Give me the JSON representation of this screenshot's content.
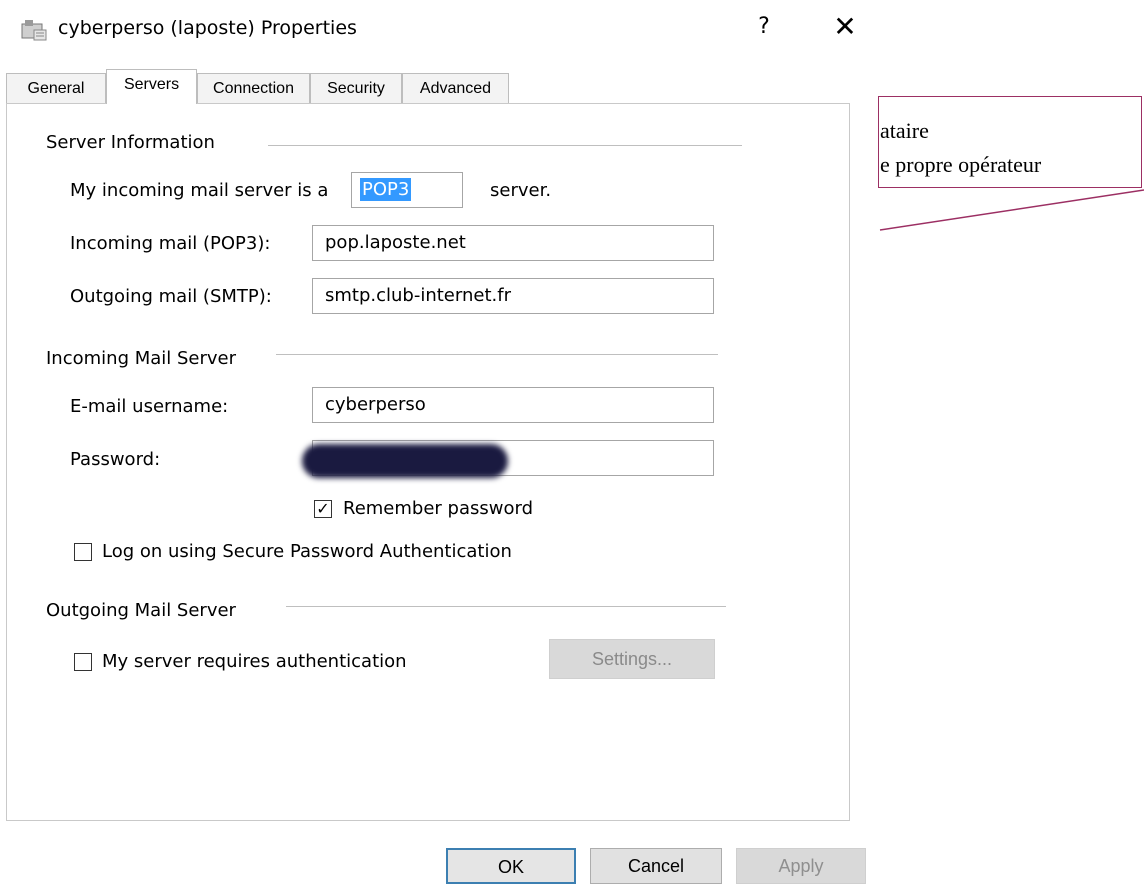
{
  "window": {
    "title": "cyberperso (laposte) Properties",
    "help_label": "?",
    "close_label": "✕"
  },
  "tabs": [
    {
      "label": "General"
    },
    {
      "label": "Servers"
    },
    {
      "label": "Connection"
    },
    {
      "label": "Security"
    },
    {
      "label": "Advanced"
    }
  ],
  "active_tab": "Servers",
  "server_info": {
    "heading": "Server Information",
    "incoming_type_prefix": "My incoming mail server is a",
    "incoming_type_value": "POP3",
    "incoming_type_suffix": "server.",
    "incoming_label": "Incoming mail (POP3):",
    "incoming_value": "pop.laposte.net",
    "outgoing_label": "Outgoing mail (SMTP):",
    "outgoing_value": "smtp.club-internet.fr"
  },
  "incoming_server": {
    "heading": "Incoming Mail Server",
    "username_label": "E-mail username:",
    "username_value": "cyberperso",
    "password_label": "Password:",
    "remember_label": "Remember password",
    "remember_checked": true,
    "spa_label": "Log on using Secure Password Authentication",
    "spa_checked": false
  },
  "outgoing_server": {
    "heading": "Outgoing Mail Server",
    "auth_label": "My server requires authentication",
    "auth_checked": false,
    "settings_label": "Settings..."
  },
  "buttons": {
    "ok": "OK",
    "cancel": "Cancel",
    "apply": "Apply"
  },
  "annotation": {
    "line1": "ataire",
    "line2": "e propre opérateur"
  },
  "colors": {
    "selection": "#3399ff",
    "callout_border": "#9c2f63",
    "redaction": "#1a1a40"
  }
}
